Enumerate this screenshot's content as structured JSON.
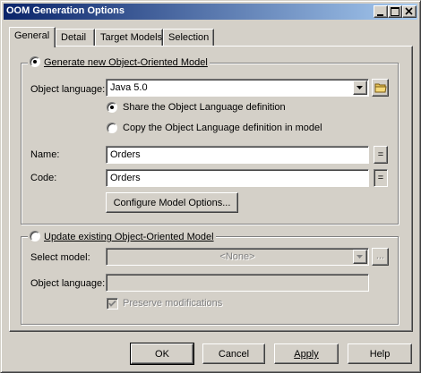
{
  "window": {
    "title": "OOM Generation Options"
  },
  "tabs": [
    {
      "label": "General",
      "active": true
    },
    {
      "label": "Detail",
      "active": false
    },
    {
      "label": "Target Models",
      "active": false
    },
    {
      "label": "Selection",
      "active": false
    }
  ],
  "generate_group": {
    "radio_label": "Generate new Object-Oriented Model",
    "radio_checked": true,
    "object_language_label": "Object language:",
    "object_language_value": "Java 5.0",
    "share_radio_label": "Share the Object Language definition",
    "share_checked": true,
    "copy_radio_label": "Copy the Object Language definition in model",
    "copy_checked": false,
    "name_label": "Name:",
    "name_value": "Orders",
    "name_eq_button": "=",
    "code_label": "Code:",
    "code_value": "Orders",
    "code_eq_button": "=",
    "configure_button": "Configure Model Options..."
  },
  "update_group": {
    "radio_label": "Update existing Object-Oriented Model",
    "radio_checked": false,
    "select_model_label": "Select model:",
    "select_model_value": "<None>",
    "browse_button": "...",
    "object_language_label": "Object language:",
    "object_language_value": "",
    "preserve_label": "Preserve modifications",
    "preserve_checked": true
  },
  "footer": {
    "ok": "OK",
    "cancel": "Cancel",
    "apply": "Apply",
    "help": "Help"
  },
  "colors": {
    "face": "#d4d0c8",
    "title_start": "#0a246a",
    "title_end": "#a6caf0",
    "disabled_text": "#808080"
  }
}
